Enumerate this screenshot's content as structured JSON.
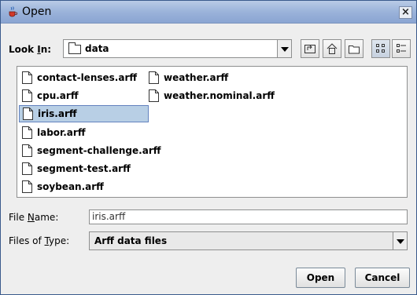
{
  "window": {
    "title": "Open",
    "close_symbol": "×"
  },
  "lookin": {
    "label_prefix": "Look ",
    "label_mnemonic": "I",
    "label_suffix": "n:",
    "value": "data"
  },
  "toolbar": {
    "buttons": [
      "up-one-level-icon",
      "home-icon",
      "new-folder-icon",
      "list-view-icon",
      "details-view-icon"
    ]
  },
  "files": [
    "contact-lenses.arff",
    "cpu.arff",
    "iris.arff",
    "labor.arff",
    "segment-challenge.arff",
    "segment-test.arff",
    "soybean.arff",
    "weather.arff",
    "weather.nominal.arff"
  ],
  "selected_file": "iris.arff",
  "filename": {
    "label_prefix": "File ",
    "label_mnemonic": "N",
    "label_suffix": "ame:",
    "value": "iris.arff"
  },
  "filetype": {
    "label_prefix": "Files of ",
    "label_mnemonic": "T",
    "label_suffix": "ype:",
    "value": "Arff data files"
  },
  "buttons": {
    "open": "Open",
    "cancel": "Cancel"
  },
  "colors": {
    "selection": "#b8cfe5",
    "titlebar": "#9bb3da"
  }
}
